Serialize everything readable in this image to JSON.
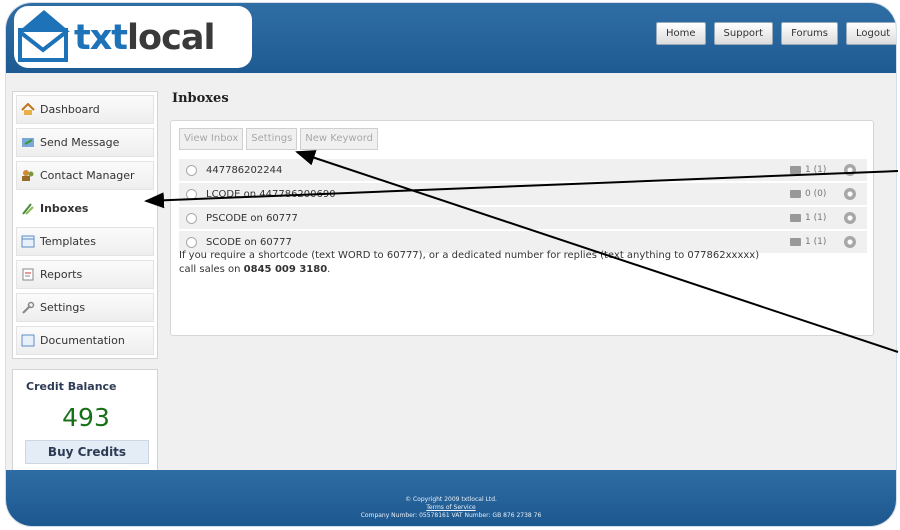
{
  "brand": {
    "part1": "txt",
    "part2": "local"
  },
  "nav": [
    "Home",
    "Support",
    "Forums",
    "Logout"
  ],
  "sidebar": {
    "items": [
      {
        "label": "Dashboard",
        "icon": "house-icon"
      },
      {
        "label": "Send Message",
        "icon": "send-message-icon"
      },
      {
        "label": "Contact Manager",
        "icon": "contacts-icon"
      },
      {
        "label": "Inboxes",
        "icon": "inbox-icon",
        "active": true
      },
      {
        "label": "Templates",
        "icon": "template-icon"
      },
      {
        "label": "Reports",
        "icon": "reports-icon"
      },
      {
        "label": "Settings",
        "icon": "wrench-icon"
      },
      {
        "label": "Documentation",
        "icon": "document-icon"
      }
    ]
  },
  "credit": {
    "title": "Credit Balance",
    "amount": "493",
    "buy_label": "Buy Credits"
  },
  "main": {
    "title": "Inboxes",
    "tabs": [
      "View Inbox",
      "Settings",
      "New Keyword"
    ],
    "inboxes": [
      {
        "name": "447786202244",
        "count": "1 (1)"
      },
      {
        "name": "LCODE on 447786200690",
        "count": "0 (0)"
      },
      {
        "name": "PSCODE on 60777",
        "count": "1 (1)"
      },
      {
        "name": "SCODE on 60777",
        "count": "1 (1)"
      }
    ],
    "note_line1": "If you require a shortcode (text WORD to 60777), or a dedicated number for replies (text anything to 077862xxxxx)",
    "note_line2_prefix": "call sales on ",
    "note_phone": "0845 009 3180",
    "note_suffix": "."
  },
  "footer": {
    "copyright": "© Copyright 2009 txtlocal Ltd.",
    "terms": "Terms of Service",
    "company": "Company Number: 05578161  VAT Number: GB 876 2738 76"
  },
  "colors": {
    "header": "#1f5b93",
    "credit_amount": "#187018",
    "brand_blue": "#1d72b8"
  }
}
